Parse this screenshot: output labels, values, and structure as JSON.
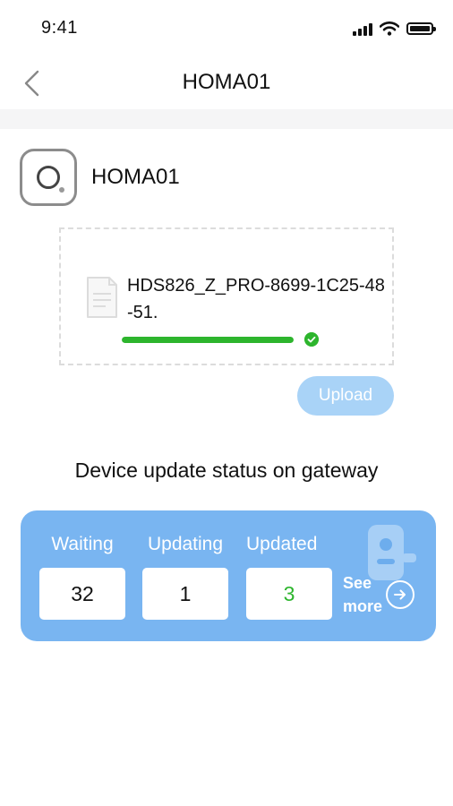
{
  "status_bar": {
    "time": "9:41"
  },
  "nav": {
    "title": "HOMA01"
  },
  "device": {
    "name": "HOMA01"
  },
  "file": {
    "name": "HDS826_Z_PRO-8699-1C25-48-51.",
    "progress": 1.0
  },
  "upload": {
    "label": "Upload"
  },
  "update_status": {
    "title": "Device update status on gateway",
    "waiting": {
      "label": "Waiting",
      "value": "32"
    },
    "updating": {
      "label": "Updating",
      "value": "1"
    },
    "updated": {
      "label": "Updated",
      "value": "3"
    },
    "see_more": "See more"
  },
  "colors": {
    "accent_blue": "#79b5f1",
    "upload_button": "#a9d3f7",
    "success_green": "#2db52d"
  },
  "icons": [
    "signal-icon",
    "wifi-icon",
    "battery-icon",
    "back-arrow-icon",
    "device-icon",
    "file-icon",
    "check-icon",
    "arrow-right-circle-icon"
  ]
}
